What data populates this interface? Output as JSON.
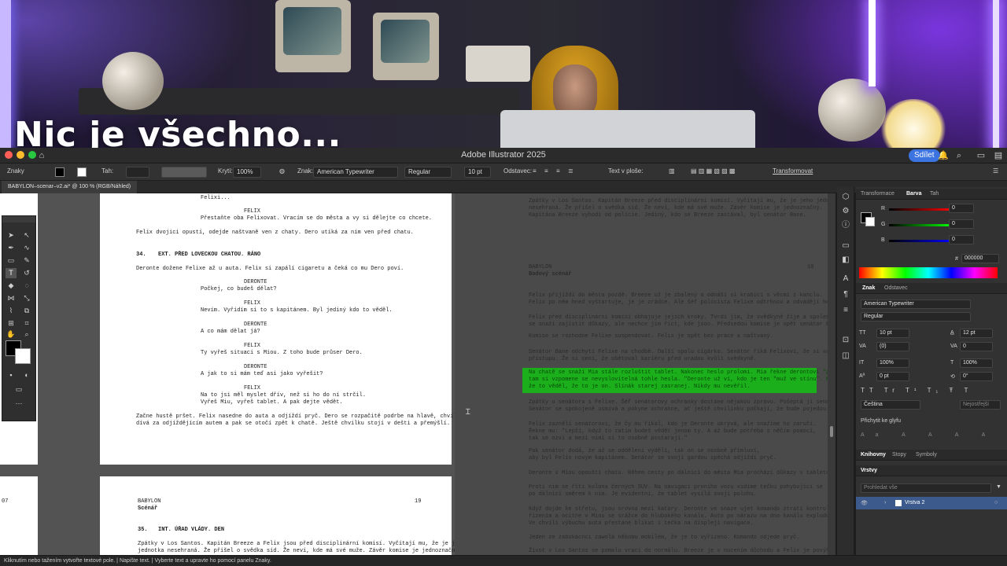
{
  "overlay_title": "Nic je všechno...",
  "titlebar": {
    "app_title": "Adobe Illustrator 2025",
    "share_label": "Sdílet"
  },
  "control_bar": {
    "selection_label": "Znaky",
    "stroke_label": "Tah:",
    "opacity_label": "Krytí:",
    "opacity_value": "100%",
    "character_label": "Znak:",
    "font_family": "American Typewriter",
    "font_style": "Regular",
    "font_size": "10 pt",
    "paragraph_label": "Odstavec:",
    "text_on_path_label": "Text v ploše:",
    "transform_label": "Transformovat"
  },
  "document_tab": "BABYLON–scenar–v2.ai* @ 100 % (RGB/Náhled)",
  "script_page_a": [
    "Felixi...",
    "FELIX",
    "Přestaňte oba Felixovat. Vracím se do města a vy si dělejte co chcete.",
    "Felix dvojici opustí, odejde naštvaně ven z chaty. Dero utíká za ním ven před chatu.",
    "34.",
    "EXT. PŘED LOVECKOU CHATOU. RÁNO",
    "Deronte dožene Felixe až u auta. Felix si zapálí cigaretu a čeká co mu Dero poví.",
    "DERONTE",
    "Počkej, co budeš dělat?",
    "FELIX",
    "Nevím. Vyřídím si to s kapitánem. Byl jediný kdo to věděl.",
    "DERONTE",
    "A co mám dělat já?",
    "FELIX",
    "Ty vyřeš situaci s Miou. Z toho bude průser Dero.",
    "DERONTE",
    "A jak to si mám teď asi jako vyřešit?",
    "FELIX",
    "Na to jsi měl myslet dřív, než si ho do ní strčil.",
    "Vyřeš Miu, vyřeš tablet. A pak dejte vědět.",
    "Začne hustě pršet. Felix nasedne do auta a odjíždí pryč. Dero se rozpačitě podrbe na hlavě, chvíly se",
    "dívá za odjíždějícím autem a pak se otočí zpět k chatě. Ještě chvilku stojí v dešti a přemýšlí."
  ],
  "script_page_b": {
    "page_left_number": "07",
    "header_title": "BABYLON",
    "header_sub": "Scénář",
    "page_number": "19",
    "scene_number": "35.",
    "scene_heading": "INT. ÚŘAD VLÁDY. DEN",
    "line1": "Zpátky v Los Santos. Kapitán Breeze a Felix jsou před disciplinární komisí. Vyčítají mu, že je jeho",
    "line2": "jednotka nesehraná. Že přišel o svědka síd. Že neví, kde má své muže. Závěr komise je jednoznačný."
  },
  "script_page_c": {
    "top_lines": [
      "Zpátky v Los Santos. Kapitán Breeze před disciplinární komisí. Vyčítají mu, že je jeho jednotka",
      "nesehraná. Že přišel o svědka síd. Že neví, kde má své muže. Závěr komise je jednoznačný.",
      "Kapitána Breeze vyhodí od policie. Jediný, kdo se Breeze zastával, byl senátor Bane."
    ],
    "header_title": "BABYLON",
    "header_sub": "Bodový scénář",
    "page_number": "10",
    "paragraphs": [
      "Felix přijíždí do města pozdě. Breeze už je zbalený a odnáší si krabici s věcmi z kanclu.",
      "Felix po něm hned vyštartuje, je je zrádce. Ale šéf policista Felixe odtrhnou a odvádějí ho pryč.",
      "Felix před disciplinární komisí obhajuje jejich kroky. Tvrdí jim, že svědkyně žije a společně s Derem",
      "se snaží zajistit důkazy, ale nechce jim říct, kde jsou. Předsedou komise je opět senátor Bane.",
      "Komise se rozhodne Felixe suspendovat. Felix je opět bez práce a naštvaný.",
      "Senátor Bane odchytí Felixe na chodbě. Další spolu cigárko. Senátor říká Felixovi, že si váží jeho",
      "přístupu. Že si cení, že obětoval kariéru před uradou kvůli svědkyně."
    ],
    "highlighted": [
      "Na chatě se snaží Mia stále rozluštit tablet. Nakonec heslo prolomí. Mia řekne derontovi \"pušťku\"",
      "tam si vzpomene se nevyslovitelná tohle hesla. \"Deronte už ví, kdo je ten \"muž ve stínu\". Mluví o tom,",
      "že to věděl, že to je on. Slínák starej zasranej. Nikdy mu nevěřil."
    ],
    "after": [
      "Zpátky u senátora s Felixe. Šéf senátorovy ochranky dostane nějakou zprávu. Pošeptá ji senátorovi.",
      "Senátor se spokojeně usmívá a pokyne ochrance, ať ještě chvilinku počkají, že bude pojedou.",
      "Felix zaznělí senátorovi, že čy mu říkal, kdo je Deronte ukrývá, ale snažíme ho zaruči.",
      "Řekne mu: \"Lepší, když to zatím budeš vědět jenom ty. A až bude potřeba s něčím pomocí,",
      "tak se ozvi a mezi nimi si to osobně postarají.\"",
      "Pak senátor dodá, že až se oddělení vydělí, tak on se osobně přimluví,",
      "aby byl Felix novým kapitánem. Senátor se svoji gardou spěchá odjíždí pryč.",
      "Deronte s Miou opouští chatu. Během cesty po dálnici do města Mia prochází důkazy v tabletu.",
      "Proti nim se řítí kolona černých SUV. Na navigaci prvního vozu vidíme tečku pohybující se",
      "po dálnici směrem k nim. Je evidentní, že tablet vysílá svoji polohu.",
      "Když dojde ke střetu, jsou srovna mezi kaťary. Deronte ve snaze ujet komando ztratí kontrolu nad",
      "řízením a ocitne v Miou se srážce do hlubokého kanálu. Auto po nárazu na dno kanálu exploduje.",
      "Ve chvíli výbuchu auta přestane blikat i tečka na displeji navigace.",
      "Jeden ze zabukácnci zawolá někomu mobilem, že je to vyřízeno. Komando odjede pryč.",
      "Život v Los Santos se pomalu vrací do normálu. Breeze je v nucením důchodu a Felix je povýšen,"
    ]
  },
  "right_panel": {
    "tabs_top": [
      "Transformace",
      "Barva",
      "Tah"
    ],
    "color_channels": [
      {
        "label": "R",
        "value": "0"
      },
      {
        "label": "G",
        "value": "0"
      },
      {
        "label": "B",
        "value": "0"
      }
    ],
    "hex_value": "000000",
    "char_tabs": [
      "Znak",
      "Odstavec"
    ],
    "font_family": "American Typewriter",
    "font_style": "Regular",
    "size": "10 pt",
    "leading": "12 pt",
    "kerning": "(0)",
    "tracking": "0",
    "vscale": "100%",
    "hscale": "100%",
    "baseline": "0 pt",
    "rotation": "0°",
    "language": "Čeština",
    "anti_alias": "Nejostřejší",
    "snap_label": "Přichytit ke glyfu",
    "lib_tabs": [
      "Knihovny",
      "Stopy",
      "Symboly"
    ],
    "layers_tab": "Vrstvy",
    "layers_search_placeholder": "Prohledat vše",
    "layer_name": "Vrstva 2"
  },
  "status_bar": "Klikn​utím nebo tažením vytvořte textové pole.  |  Napište text.  |  Vyberte text a upravte ho pomocí panelu Znaky."
}
